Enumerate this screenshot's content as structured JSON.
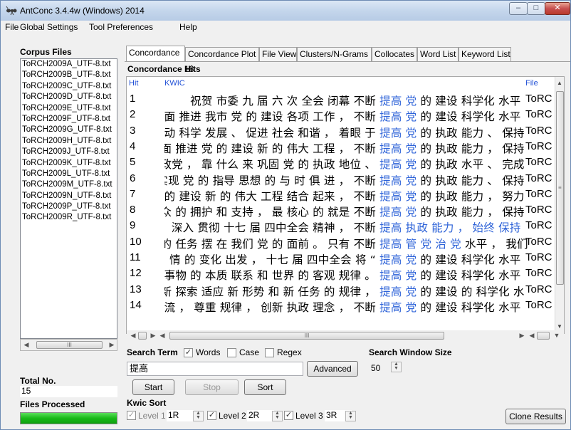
{
  "window": {
    "title": "AntConc 3.4.4w (Windows) 2014",
    "min_glyph": "–",
    "max_glyph": "□",
    "close_glyph": "✕"
  },
  "menu": [
    "File",
    "Global Settings",
    "Tool Preferences",
    "Help"
  ],
  "corpus": {
    "label": "Corpus Files",
    "files": [
      "ToRCH2009A_UTF-8.txt",
      "ToRCH2009B_UTF-8.txt",
      "ToRCH2009C_UTF-8.txt",
      "ToRCH2009D_UTF-8.txt",
      "ToRCH2009E_UTF-8.txt",
      "ToRCH2009F_UTF-8.txt",
      "ToRCH2009G_UTF-8.txt",
      "ToRCH2009H_UTF-8.txt",
      "ToRCH2009J_UTF-8.txt",
      "ToRCH2009K_UTF-8.txt",
      "ToRCH2009L_UTF-8.txt",
      "ToRCH2009M_UTF-8.txt",
      "ToRCH2009N_UTF-8.txt",
      "ToRCH2009P_UTF-8.txt",
      "ToRCH2009R_UTF-8.txt"
    ],
    "scroll_grip": "III"
  },
  "totals": {
    "total_label": "Total No.",
    "total_value": "15",
    "processed_label": "Files Processed",
    "processed_fraction": 1.0
  },
  "tabs": [
    "Concordance",
    "Concordance Plot",
    "File View",
    "Clusters/N-Grams",
    "Collocates",
    "Word List",
    "Keyword List"
  ],
  "active_tab": 0,
  "hits": {
    "label": "Concordance Hits",
    "count": "18"
  },
  "columns": {
    "hit": "Hit",
    "kwic": "KWIC",
    "file": "File"
  },
  "rows": [
    {
      "n": "1",
      "left": "祝贺 市委 九 届 六 次 全会 闭幕  不断",
      "kw": "提高 党",
      "right": "的 建设 科学化 水平",
      "file": "ToRC"
    },
    {
      "n": "2",
      "left": "面 推进 我市 党 的 建设 各项 工作 ， 不断",
      "kw": "提高 党",
      "right": "的 建设 科学化 水平",
      "file": "ToRC"
    },
    {
      "n": "3",
      "left": "动 科学 发展 、 促进 社会 和谐 ， 着眼 于",
      "kw": "提高 党",
      "right": "的 执政 能力 、 保持",
      "file": "ToRC"
    },
    {
      "n": "4",
      "left": "面 推进 党 的 建设 新 的 伟大 工程 ， 不断",
      "kw": "提高 党",
      "right": "的 执政 能力 ， 保持",
      "file": "ToRC"
    },
    {
      "n": "5",
      "left": "执政党 ， 靠 什么 来 巩固 党 的 执政 地位 、",
      "kw": "提高 党",
      "right": "的 执政 水平 、 完成",
      "file": "ToRC"
    },
    {
      "n": "6",
      "left": "实现 党 的 指导 思想 的 与 时 俱 进 ， 不断",
      "kw": "提高 党",
      "right": "的 执政 能力 、 保持",
      "file": "ToRC"
    },
    {
      "n": "7",
      "left": "的 建设 新 的 伟大 工程 结合 起来 ， 不断",
      "kw": "提高 党",
      "right": "的 执政 能力 ， 努力",
      "file": "ToRC"
    },
    {
      "n": "8",
      "left": "众 的 拥护 和 支持 ， 最 核心 的 就是 不断",
      "kw": "提高 党",
      "right": "的 执政 能力 ， 保持",
      "file": "ToRC"
    },
    {
      "n": "9",
      "left": "深入 贯彻 十七 届 四中全会 精神 ， 不断",
      "kw": "提高 执政 能力 ， 始终 保持",
      "right": "",
      "file": "ToRC"
    },
    {
      "n": "10",
      "left": "的 任务 摆 在 我们 党 的 面前 。 只有 不断",
      "kw": "提高 管 党 治 党",
      "right": "水平 ， 我们",
      "file": "ToRC"
    },
    {
      "n": "11",
      "left": "情 的 变化 出发 ， 十七 届 四中全会 将 “",
      "kw": "提高 党",
      "right": "的 建设 科学化 水平",
      "file": "ToRC"
    },
    {
      "n": "12",
      "left": "事物 的 本质 联系 和 世界 的 客观 规律 。",
      "kw": "提高 党",
      "right": "的 建设 科学化 水平",
      "file": "ToRC"
    },
    {
      "n": "13",
      "left": "新 探索 适应 新 形势 和 新 任务 的 规律 ，",
      "kw": "提高 党",
      "right": "的 建设 的 科学化 水",
      "file": "ToRC"
    },
    {
      "n": "14",
      "left": "流 ， 尊重 规律 ， 创新 执政 理念 ， 不断",
      "kw": "提高 党",
      "right": "的 建设 科学化 水平",
      "file": "ToRC"
    }
  ],
  "table_scroll": {
    "grip": "III",
    "vgrip": "≡"
  },
  "search": {
    "label": "Search Term",
    "words_label": "Words",
    "words_checked": true,
    "case_label": "Case",
    "case_checked": false,
    "regex_label": "Regex",
    "regex_checked": false,
    "term_value": "提高",
    "advanced_label": "Advanced",
    "window_size_label": "Search Window Size",
    "window_size_value": "50"
  },
  "buttons": {
    "start": "Start",
    "stop": "Stop",
    "sort": "Sort",
    "clone": "Clone Results"
  },
  "kwic_sort": {
    "label": "Kwic Sort",
    "level1_label": "Level 1",
    "level1_value": "1R",
    "level1_checked": true,
    "level2_label": "Level 2",
    "level2_value": "2R",
    "level2_checked": true,
    "level3_label": "Level 3",
    "level3_value": "3R",
    "level3_checked": true
  }
}
